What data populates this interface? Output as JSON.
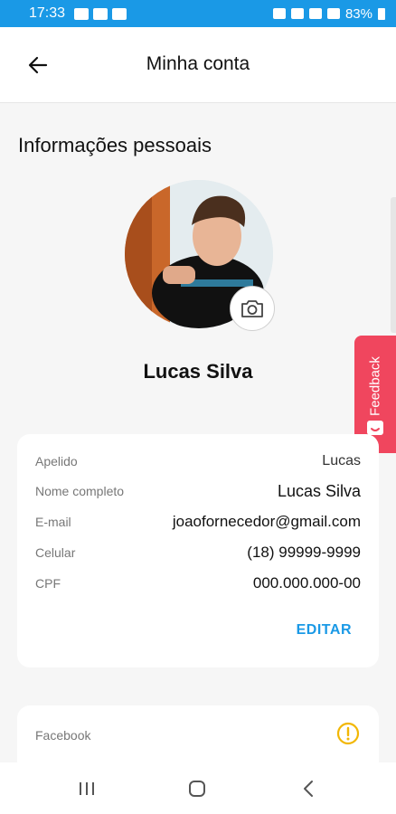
{
  "status_bar": {
    "time": "17:33",
    "battery": "83%",
    "left_icons": [
      "image-icon",
      "puzzle-icon",
      "mail-icon"
    ],
    "right_icons": [
      "alarm-icon",
      "mute-icon",
      "wifi-icon",
      "signal-icon",
      "battery-icon"
    ]
  },
  "app_bar": {
    "title": "Minha conta",
    "back_icon": "arrow-left-icon"
  },
  "section_title": "Informações pessoais",
  "profile": {
    "name": "Lucas Silva",
    "camera_icon": "camera-icon"
  },
  "info": {
    "rows": [
      {
        "label": "Apelido",
        "value": "Lucas"
      },
      {
        "label": "Nome completo",
        "value": "Lucas Silva"
      },
      {
        "label": "E-mail",
        "value": "joaofornecedor@gmail.com"
      },
      {
        "label": "Celular",
        "value": "(18) 99999-9999"
      },
      {
        "label": "CPF",
        "value": "000.000.000-00"
      }
    ],
    "edit_label": "EDITAR"
  },
  "social": {
    "facebook_label": "Facebook",
    "status_icon": "warning-icon"
  },
  "feedback": {
    "label": "Feedback"
  },
  "nav": {
    "icons": [
      "recent-apps-icon",
      "home-icon",
      "back-icon"
    ]
  },
  "colors": {
    "primary": "#1a99e6",
    "feedback": "#f0465e",
    "warning": "#f2b705",
    "background": "#f6f6f6"
  }
}
